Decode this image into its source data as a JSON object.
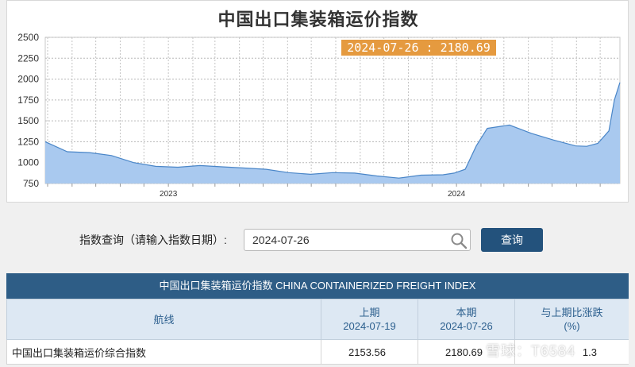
{
  "chart": {
    "title": "中国出口集装箱运价指数",
    "tooltip": "2024-07-26 : 2180.69"
  },
  "chart_data": {
    "type": "area",
    "title": "中国出口集装箱运价指数",
    "xlabel": "",
    "ylabel": "",
    "ylim": [
      750,
      2500
    ],
    "yticks": [
      750,
      1000,
      1250,
      1500,
      1750,
      2000,
      2250,
      2500
    ],
    "xticks": [
      "2023",
      "2024"
    ],
    "xlim": [
      "2022-07-29",
      "2024-07-26"
    ],
    "grid": true,
    "color": "#a9c9ef",
    "line_color": "#4a86c8",
    "x": [
      "2022-07-29",
      "2022-08-26",
      "2022-09-23",
      "2022-10-21",
      "2022-11-18",
      "2022-12-16",
      "2023-01-13",
      "2023-02-10",
      "2023-03-10",
      "2023-04-07",
      "2023-05-05",
      "2023-06-02",
      "2023-06-30",
      "2023-07-28",
      "2023-08-25",
      "2023-09-22",
      "2023-10-20",
      "2023-11-17",
      "2023-12-15",
      "2023-12-29",
      "2024-01-12",
      "2024-01-26",
      "2024-02-09",
      "2024-03-08",
      "2024-04-05",
      "2024-05-03",
      "2024-05-31",
      "2024-06-14",
      "2024-06-28",
      "2024-07-12",
      "2024-07-19",
      "2024-07-26"
    ],
    "values": [
      1250,
      1130,
      1120,
      1085,
      1000,
      955,
      945,
      965,
      950,
      935,
      920,
      880,
      860,
      880,
      875,
      840,
      815,
      850,
      855,
      875,
      920,
      1200,
      1410,
      1450,
      1350,
      1270,
      1200,
      1195,
      1230,
      1380,
      1750,
      1960,
      2100,
      2153.56,
      2180.69
    ]
  },
  "query": {
    "label": "指数查询（请输入指数日期）:",
    "value": "2024-07-26",
    "button": "查询"
  },
  "table": {
    "header": "中国出口集装箱运价指数 CHINA CONTAINERIZED FREIGHT INDEX",
    "columns": {
      "route": "航线",
      "prev_label": "上期",
      "prev_date": "2024-07-19",
      "curr_label": "本期",
      "curr_date": "2024-07-26",
      "change_label": "与上期比涨跌",
      "change_unit": "(%)"
    },
    "rows": [
      {
        "route": "中国出口集装箱运价综合指数",
        "prev": "2153.56",
        "curr": "2180.69",
        "change": "1.3"
      }
    ]
  },
  "watermark": "雪球：T6584"
}
